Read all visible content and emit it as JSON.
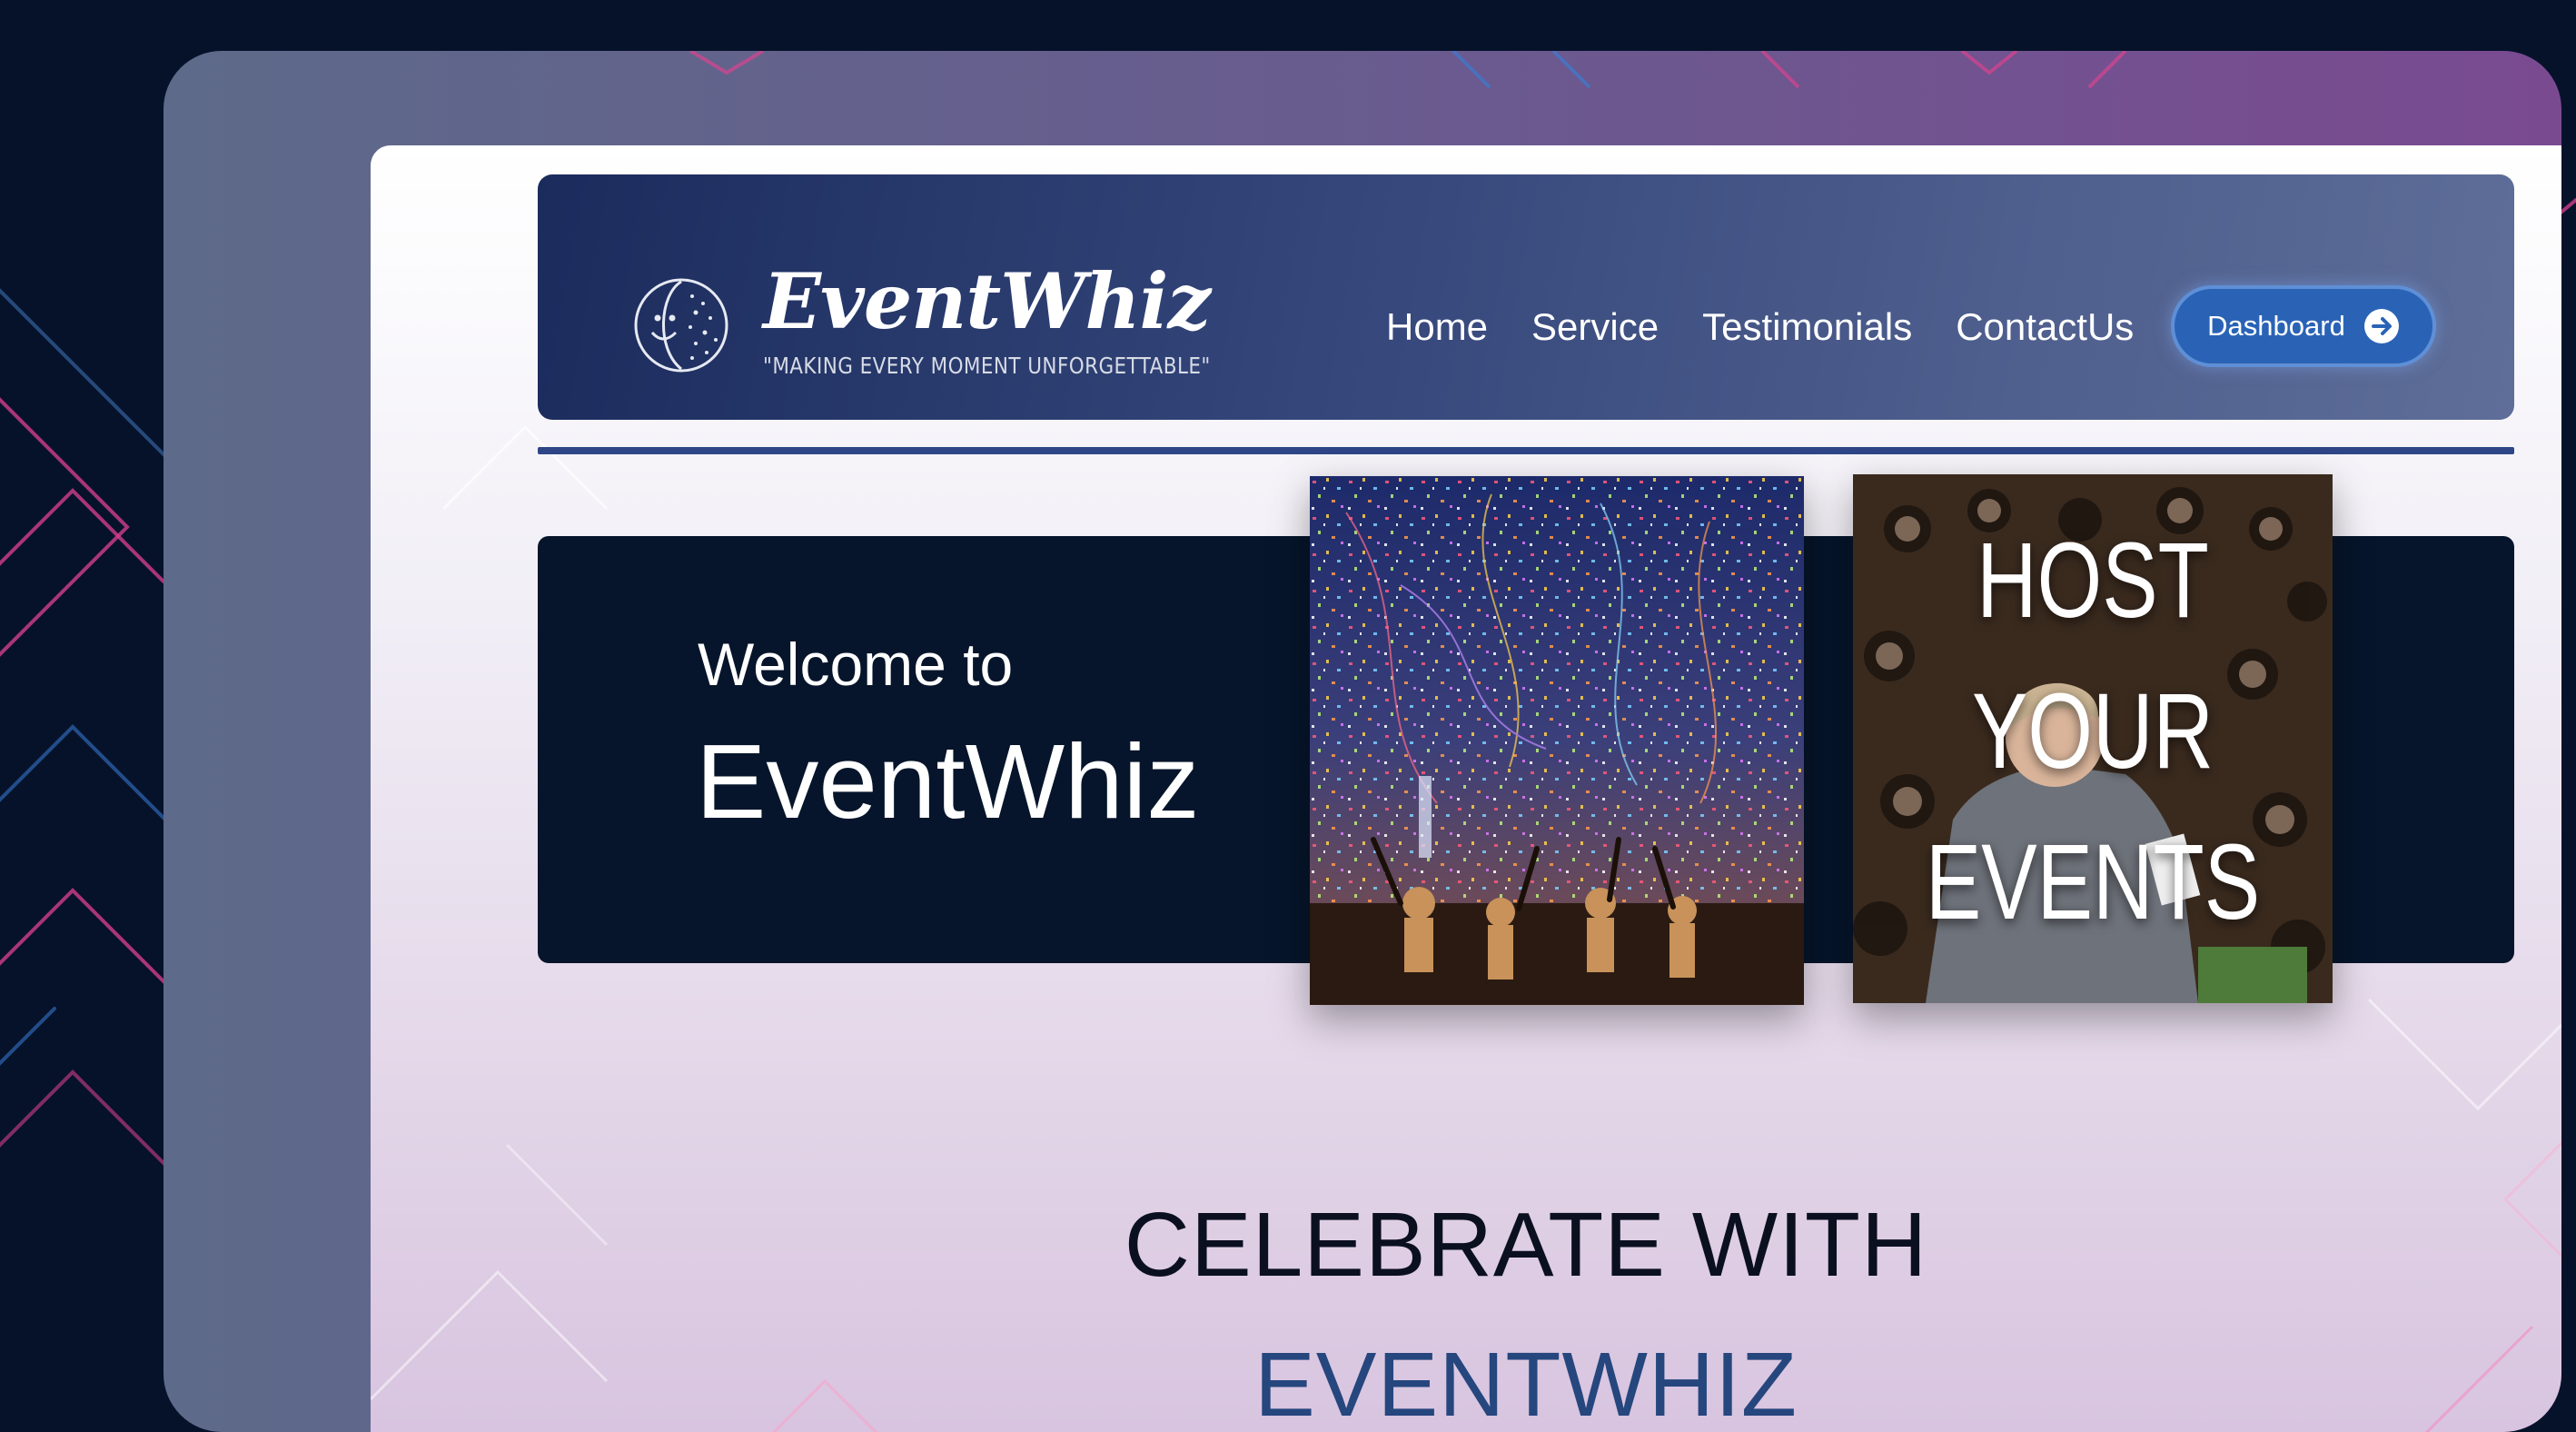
{
  "brand": {
    "name": "EventWhiz",
    "tagline": "\"MAKING EVERY MOMENT UNFORGETTABLE\"",
    "logo_icon": "smiling-moon-emblem-icon"
  },
  "nav": {
    "links": [
      "Home",
      "Service",
      "Testimonials",
      "ContactUs"
    ],
    "dashboard_label": "Dashboard",
    "dashboard_icon": "arrow-right-circle-icon"
  },
  "hero": {
    "welcome_line": "Welcome to",
    "brand_line": "EventWhiz",
    "photo_confetti_icon": "confetti-celebration-photo",
    "photo_speaker_icon": "conference-speaker-photo",
    "host_lines": [
      "HOST",
      "YOUR",
      "EVENTS"
    ]
  },
  "section": {
    "heading_line1": "CELEBRATE WITH",
    "heading_line2": "EVENTWHIZ"
  },
  "colors": {
    "background": "#06122a",
    "navbar": "#34467a",
    "hero": "#06152b",
    "accent_button": "#2a63b6",
    "divider": "#2e4687",
    "heading_accent": "#26467e"
  }
}
